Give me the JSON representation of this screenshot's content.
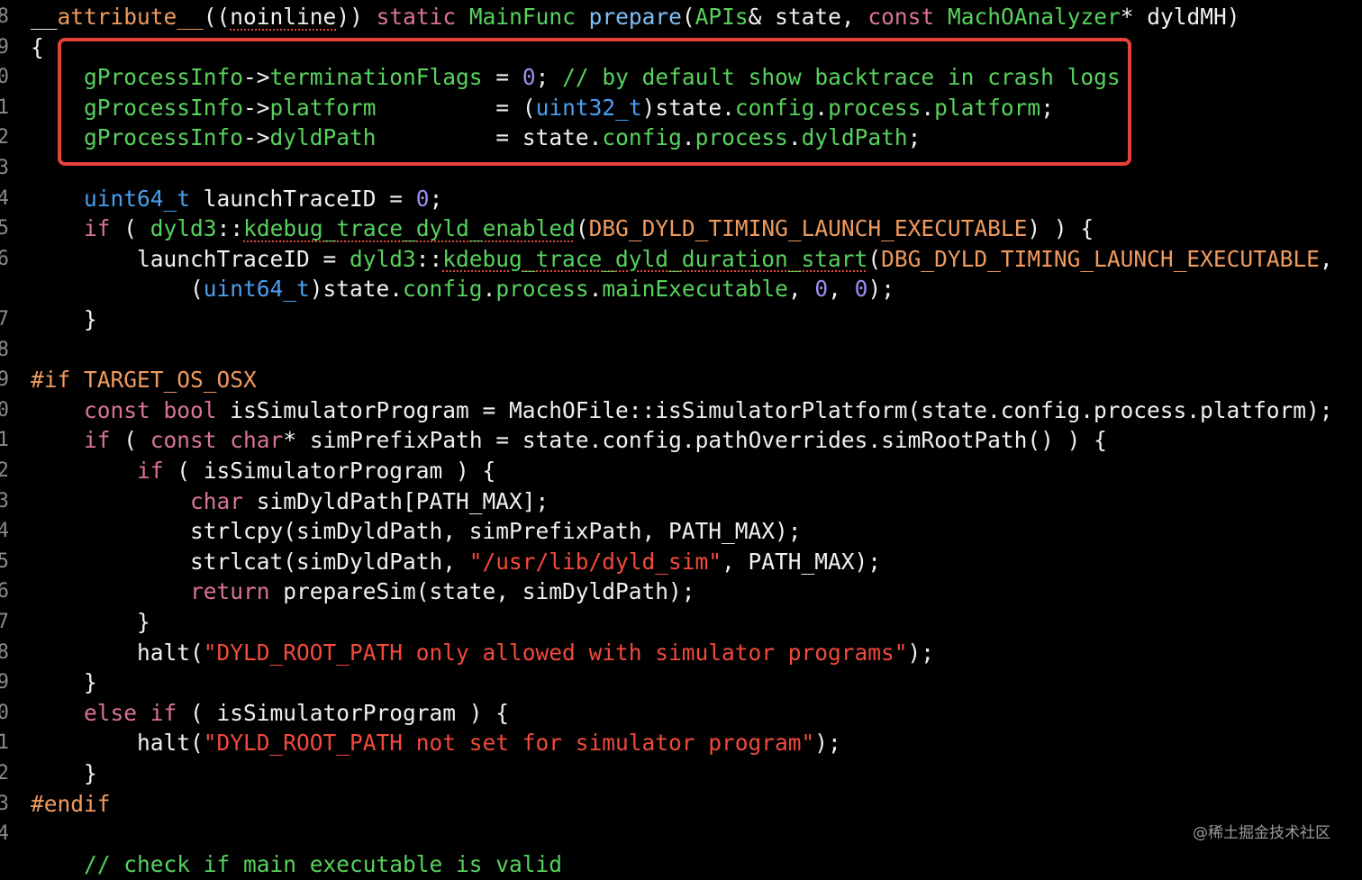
{
  "gutter": {
    "numbers": [
      "8",
      "9",
      "0",
      "1",
      "2",
      "3",
      "4",
      "5",
      "6",
      "",
      "7",
      "8",
      "9",
      "0",
      "1",
      "2",
      "3",
      "4",
      "5",
      "6",
      "7",
      "8",
      "9",
      "0",
      "1",
      "2",
      "3",
      "4"
    ]
  },
  "code": {
    "lines": [
      [
        [
          "tx",
          "__"
        ],
        [
          "pp",
          "attribute__"
        ],
        [
          "tx",
          "(("
        ],
        [
          "wavy",
          "noinline"
        ],
        [
          "tx",
          ")) "
        ],
        [
          "kw",
          "static "
        ],
        [
          "cls",
          "MainFunc "
        ],
        [
          "fn",
          "prepare"
        ],
        [
          "tx",
          "("
        ],
        [
          "cls",
          "APIs"
        ],
        [
          "tx",
          "& state, "
        ],
        [
          "kw",
          "const "
        ],
        [
          "cls",
          "MachOAnalyzer"
        ],
        [
          "tx",
          "* dyldMH)"
        ]
      ],
      [
        [
          "tx",
          "{"
        ]
      ],
      [
        [
          "tx",
          "    "
        ],
        [
          "mem",
          "gProcessInfo"
        ],
        [
          "tx",
          "->"
        ],
        [
          "mem",
          "terminationFlags"
        ],
        [
          "tx",
          " = "
        ],
        [
          "num",
          "0"
        ],
        [
          "tx",
          "; "
        ],
        [
          "cm",
          "// by default show backtrace in crash logs"
        ]
      ],
      [
        [
          "tx",
          "    "
        ],
        [
          "mem",
          "gProcessInfo"
        ],
        [
          "tx",
          "->"
        ],
        [
          "mem",
          "platform"
        ],
        [
          "tx",
          "         = ("
        ],
        [
          "ty",
          "uint32_t"
        ],
        [
          "tx",
          ")state."
        ],
        [
          "mem",
          "config"
        ],
        [
          "tx",
          "."
        ],
        [
          "mem",
          "process"
        ],
        [
          "tx",
          "."
        ],
        [
          "mem",
          "platform"
        ],
        [
          "tx",
          ";"
        ]
      ],
      [
        [
          "tx",
          "    "
        ],
        [
          "mem",
          "gProcessInfo"
        ],
        [
          "tx",
          "->"
        ],
        [
          "mem",
          "dyldPath"
        ],
        [
          "tx",
          "         = state."
        ],
        [
          "mem",
          "config"
        ],
        [
          "tx",
          "."
        ],
        [
          "mem",
          "process"
        ],
        [
          "tx",
          "."
        ],
        [
          "mem",
          "dyldPath"
        ],
        [
          "tx",
          ";"
        ]
      ],
      [
        [
          "tx",
          ""
        ]
      ],
      [
        [
          "tx",
          "    "
        ],
        [
          "ty",
          "uint64_t"
        ],
        [
          "tx",
          " launchTraceID = "
        ],
        [
          "num",
          "0"
        ],
        [
          "tx",
          ";"
        ]
      ],
      [
        [
          "tx",
          "    "
        ],
        [
          "kw",
          "if"
        ],
        [
          "tx",
          " ( "
        ],
        [
          "cls",
          "dyld3"
        ],
        [
          "tx",
          "::"
        ],
        [
          "wavyg",
          "kdebug_trace_dyld_enabled"
        ],
        [
          "tx",
          "("
        ],
        [
          "pp",
          "DBG_DYLD_TIMING_LAUNCH_EXECUTABLE"
        ],
        [
          "tx",
          ") ) {"
        ]
      ],
      [
        [
          "tx",
          "        launchTraceID = "
        ],
        [
          "cls",
          "dyld3"
        ],
        [
          "tx",
          "::"
        ],
        [
          "wavyg",
          "kdebug_trace_dyld_duration_start"
        ],
        [
          "tx",
          "("
        ],
        [
          "pp",
          "DBG_DYLD_TIMING_LAUNCH_EXECUTABLE"
        ],
        [
          "tx",
          ","
        ]
      ],
      [
        [
          "tx",
          "            ("
        ],
        [
          "ty",
          "uint64_t"
        ],
        [
          "tx",
          ")state."
        ],
        [
          "mem",
          "config"
        ],
        [
          "tx",
          "."
        ],
        [
          "mem",
          "process"
        ],
        [
          "tx",
          "."
        ],
        [
          "mem",
          "mainExecutable"
        ],
        [
          "tx",
          ", "
        ],
        [
          "num",
          "0"
        ],
        [
          "tx",
          ", "
        ],
        [
          "num",
          "0"
        ],
        [
          "tx",
          ");"
        ]
      ],
      [
        [
          "tx",
          "    }"
        ]
      ],
      [
        [
          "tx",
          ""
        ]
      ],
      [
        [
          "pp",
          "#if TARGET_OS_OSX"
        ]
      ],
      [
        [
          "tx",
          "    "
        ],
        [
          "kw",
          "const bool"
        ],
        [
          "tx",
          " isSimulatorProgram = MachOFile::isSimulatorPlatform(state.config.process.platform);"
        ]
      ],
      [
        [
          "tx",
          "    "
        ],
        [
          "kw",
          "if"
        ],
        [
          "tx",
          " ( "
        ],
        [
          "kw",
          "const char"
        ],
        [
          "tx",
          "* simPrefixPath = state.config.pathOverrides.simRootPath() ) {"
        ]
      ],
      [
        [
          "tx",
          "        "
        ],
        [
          "kw",
          "if"
        ],
        [
          "tx",
          " ( isSimulatorProgram ) {"
        ]
      ],
      [
        [
          "tx",
          "            "
        ],
        [
          "kw",
          "char"
        ],
        [
          "tx",
          " simDyldPath[PATH_MAX];"
        ]
      ],
      [
        [
          "tx",
          "            strlcpy(simDyldPath, simPrefixPath, PATH_MAX);"
        ]
      ],
      [
        [
          "tx",
          "            strlcat(simDyldPath, "
        ],
        [
          "st",
          "\"/usr/lib/dyld_sim\""
        ],
        [
          "tx",
          ", PATH_MAX);"
        ]
      ],
      [
        [
          "tx",
          "            "
        ],
        [
          "kw",
          "return"
        ],
        [
          "tx",
          " prepareSim(state, simDyldPath);"
        ]
      ],
      [
        [
          "tx",
          "        }"
        ]
      ],
      [
        [
          "tx",
          "        halt("
        ],
        [
          "st",
          "\"DYLD_ROOT_PATH only allowed with simulator programs\""
        ],
        [
          "tx",
          ");"
        ]
      ],
      [
        [
          "tx",
          "    }"
        ]
      ],
      [
        [
          "tx",
          "    "
        ],
        [
          "kw",
          "else if"
        ],
        [
          "tx",
          " ( isSimulatorProgram ) {"
        ]
      ],
      [
        [
          "tx",
          "        halt("
        ],
        [
          "st",
          "\"DYLD_ROOT_PATH not set for simulator program\""
        ],
        [
          "tx",
          ");"
        ]
      ],
      [
        [
          "tx",
          "    }"
        ]
      ],
      [
        [
          "pp",
          "#endif"
        ]
      ],
      [
        [
          "tx",
          ""
        ]
      ],
      [
        [
          "tx",
          "    "
        ],
        [
          "cm",
          "// check if main executable is valid"
        ]
      ]
    ]
  },
  "watermark": "@稀土掘金技术社区",
  "colors": {
    "background": "#000000",
    "highlight_border": "#e8403b"
  }
}
